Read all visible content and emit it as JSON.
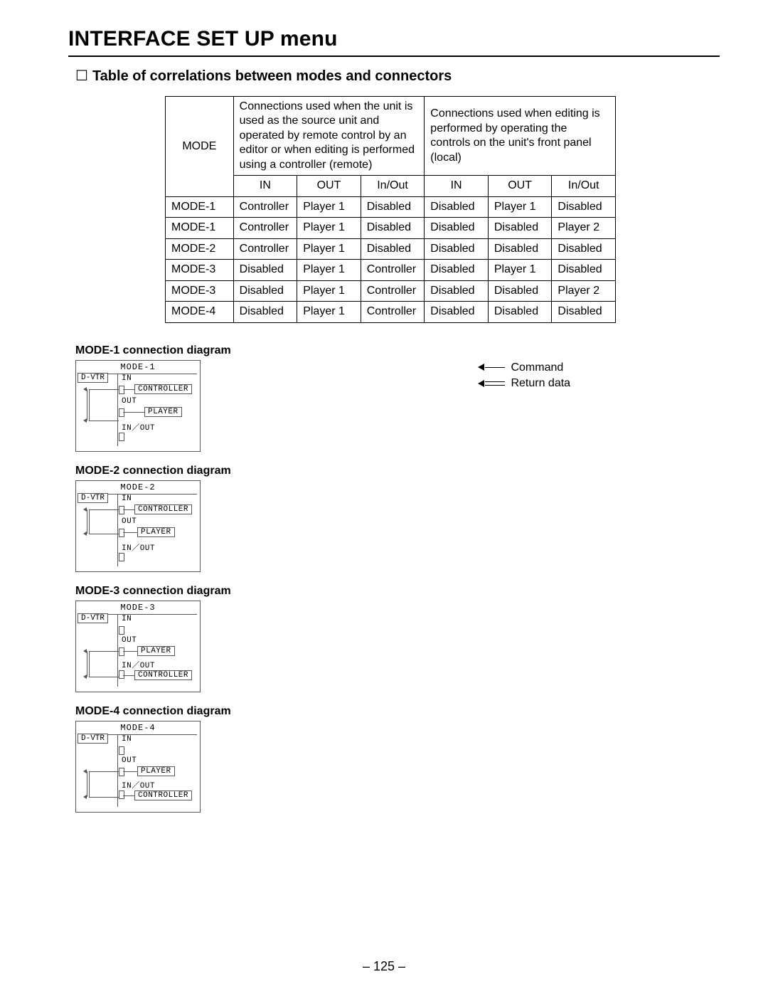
{
  "page_title": "INTERFACE SET UP menu",
  "section_title": "Table of correlations between modes and connectors",
  "table": {
    "header_mode": "MODE",
    "header_remote": "Connections used when the unit is used as the source unit and operated by remote control by an editor or when editing is performed using a controller (remote)",
    "header_local": "Connections used when editing is performed by operating the controls on the unit's front panel (local)",
    "sub_in": "IN",
    "sub_out": "OUT",
    "sub_inout": "In/Out",
    "rows": [
      {
        "mode": "MODE-1",
        "r_in": "Controller",
        "r_out": "Player 1",
        "r_io": "Disabled",
        "l_in": "Disabled",
        "l_out": "Player 1",
        "l_io": "Disabled"
      },
      {
        "mode": "MODE-1",
        "r_in": "Controller",
        "r_out": "Player 1",
        "r_io": "Disabled",
        "l_in": "Disabled",
        "l_out": "Disabled",
        "l_io": "Player 2"
      },
      {
        "mode": "MODE-2",
        "r_in": "Controller",
        "r_out": "Player 1",
        "r_io": "Disabled",
        "l_in": "Disabled",
        "l_out": "Disabled",
        "l_io": "Disabled"
      },
      {
        "mode": "MODE-3",
        "r_in": "Disabled",
        "r_out": "Player 1",
        "r_io": "Controller",
        "l_in": "Disabled",
        "l_out": "Player 1",
        "l_io": "Disabled"
      },
      {
        "mode": "MODE-3",
        "r_in": "Disabled",
        "r_out": "Player 1",
        "r_io": "Controller",
        "l_in": "Disabled",
        "l_out": "Disabled",
        "l_io": "Player 2"
      },
      {
        "mode": "MODE-4",
        "r_in": "Disabled",
        "r_out": "Player 1",
        "r_io": "Controller",
        "l_in": "Disabled",
        "l_out": "Disabled",
        "l_io": "Disabled"
      }
    ]
  },
  "legend": {
    "command": "Command",
    "return_data": "Return data"
  },
  "diagrams": {
    "mode1": {
      "heading": "MODE-1 connection diagram",
      "title": "MODE-1",
      "dvtr": "D-VTR",
      "in": "IN",
      "out": "OUT",
      "inout": "IN／OUT",
      "controller": "CONTROLLER",
      "player": "PLAYER"
    },
    "mode2": {
      "heading": "MODE-2 connection diagram",
      "title": "MODE-2",
      "dvtr": "D-VTR",
      "in": "IN",
      "out": "OUT",
      "inout": "IN／OUT",
      "controller": "CONTROLLER",
      "player": "PLAYER"
    },
    "mode3": {
      "heading": "MODE-3 connection diagram",
      "title": "MODE-3",
      "dvtr": "D-VTR",
      "in": "IN",
      "out": "OUT",
      "inout": "IN／OUT",
      "controller": "CONTROLLER",
      "player": "PLAYER"
    },
    "mode4": {
      "heading": "MODE-4 connection diagram",
      "title": "MODE-4",
      "dvtr": "D-VTR",
      "in": "IN",
      "out": "OUT",
      "inout": "IN／OUT",
      "controller": "CONTROLLER",
      "player": "PLAYER"
    }
  },
  "page_number": "– 125 –"
}
